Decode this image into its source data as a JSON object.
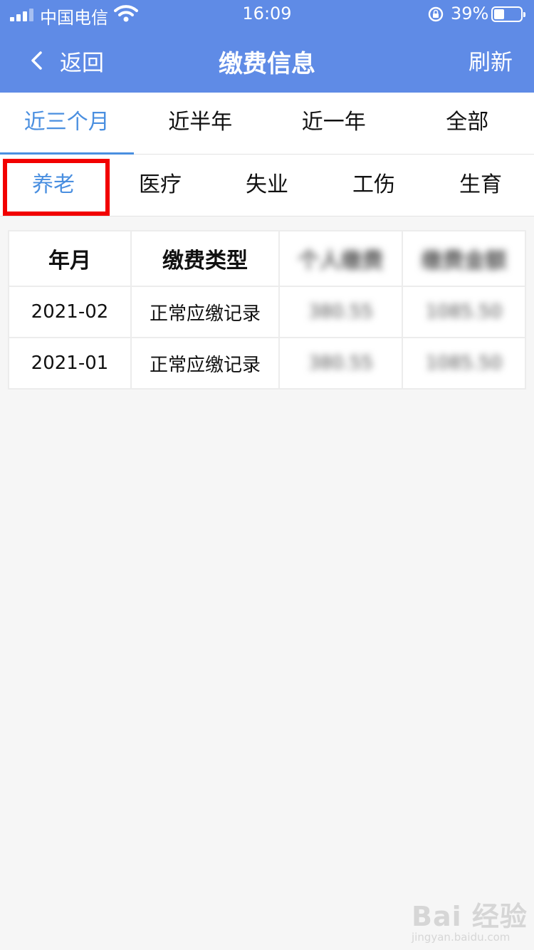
{
  "status_bar": {
    "carrier": "中国电信",
    "time": "16:09",
    "battery_percent": "39%",
    "battery_level": 0.39
  },
  "nav": {
    "back_label": "返回",
    "title": "缴费信息",
    "refresh_label": "刷新"
  },
  "period_tabs": [
    {
      "label": "近三个月",
      "active": true
    },
    {
      "label": "近半年",
      "active": false
    },
    {
      "label": "近一年",
      "active": false
    },
    {
      "label": "全部",
      "active": false
    }
  ],
  "type_tabs": [
    {
      "label": "养老",
      "active": true
    },
    {
      "label": "医疗",
      "active": false
    },
    {
      "label": "失业",
      "active": false
    },
    {
      "label": "工伤",
      "active": false
    },
    {
      "label": "生育",
      "active": false
    }
  ],
  "table": {
    "headers": [
      "年月",
      "缴费类型",
      "个人缴费",
      "缴费金额"
    ],
    "rows": [
      [
        "2021-02",
        "正常应缴记录",
        "380.55",
        "1085.50"
      ],
      [
        "2021-01",
        "正常应缴记录",
        "380.55",
        "1085.50"
      ]
    ]
  },
  "watermark": {
    "logo": "Bai 经验",
    "url": "jingyan.baidu.com"
  },
  "colors": {
    "nav_bg": "#5f8be6",
    "accent": "#4a8fe0",
    "highlight": "#f20000"
  }
}
